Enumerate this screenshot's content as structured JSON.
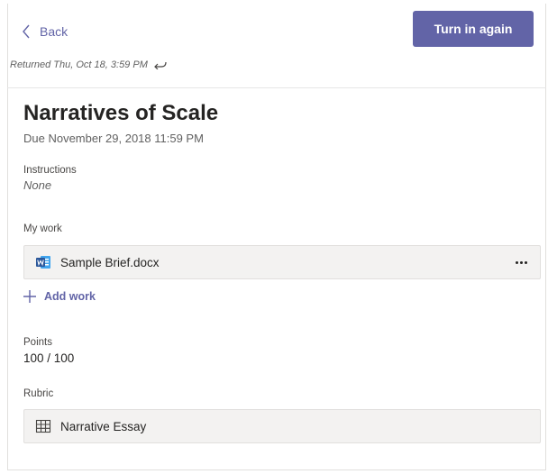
{
  "header": {
    "back_label": "Back",
    "turn_in_label": "Turn in again",
    "returned_text": "Returned Thu, Oct 18, 3:59 PM"
  },
  "assignment": {
    "title": "Narratives of Scale",
    "due": "Due November 29, 2018 11:59 PM",
    "instructions_label": "Instructions",
    "instructions_value": "None",
    "my_work_label": "My work",
    "file_name": "Sample Brief.docx",
    "add_work_label": "Add work",
    "points_label": "Points",
    "points_value": "100 / 100",
    "rubric_label": "Rubric",
    "rubric_name": "Narrative Essay"
  },
  "icons": {
    "back": "chevron-left-icon",
    "returned": "return-arrow-icon",
    "file": "word-document-icon",
    "more": "more-options-icon",
    "add": "plus-icon",
    "rubric": "grid-table-icon"
  },
  "colors": {
    "accent": "#6264a7",
    "word_blue": "#2b579a"
  }
}
